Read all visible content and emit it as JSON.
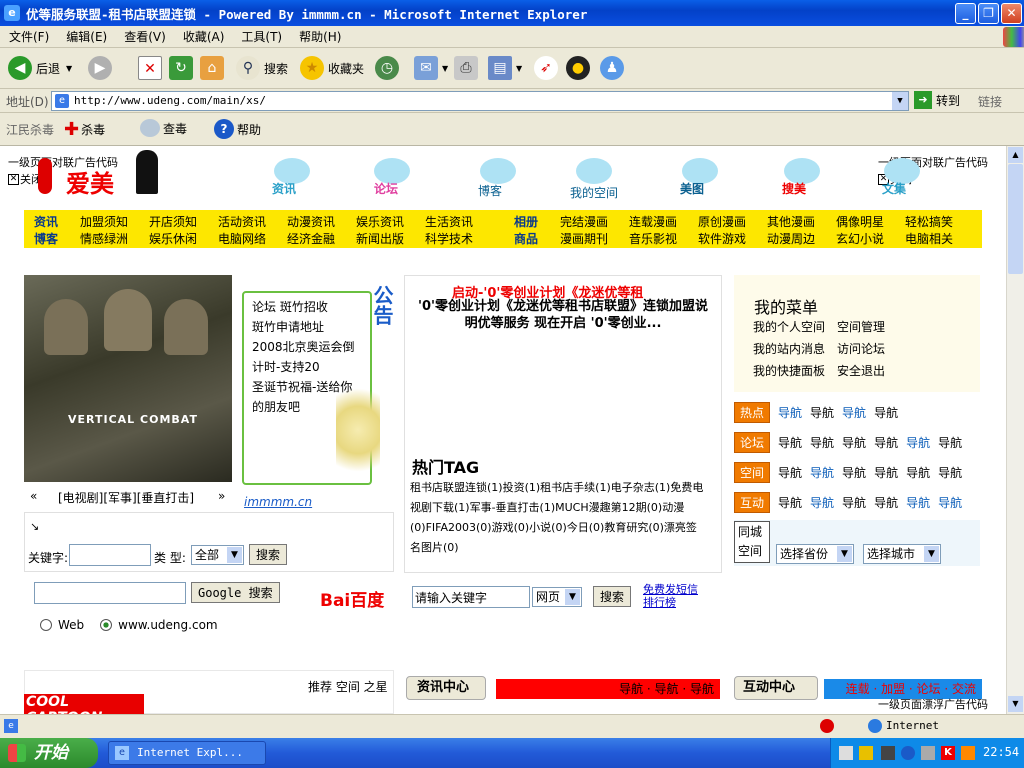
{
  "window": {
    "title": "优等服务联盟-租书店联盟连锁 - Powered By immmm.cn - Microsoft Internet Explorer",
    "minimize": "_",
    "maximize": "❐",
    "close": "✕"
  },
  "menu": [
    "文件(F)",
    "编辑(E)",
    "查看(V)",
    "收藏(A)",
    "工具(T)",
    "帮助(H)"
  ],
  "toolbar": {
    "back": "后退",
    "search": "搜索",
    "favorites": "收藏夹"
  },
  "address": {
    "label": "地址(D)",
    "url": "http://www.udeng.com/main/xs/",
    "go": "转到",
    "links": "链接"
  },
  "linksbar": {
    "label": "江民杀毒",
    "kill": "杀毒",
    "scan": "查毒",
    "help": "帮助"
  },
  "page": {
    "ad_left_text": "一级页面对联广告代码",
    "ad_left_close": "关闭",
    "ad_right_text": "一级页面对联广告代码",
    "ad_right_close": "关闭",
    "logo_text": "爱美",
    "nav_icons": [
      "资讯",
      "论坛",
      "博客",
      "我的空间",
      "美图",
      "搜美",
      "文集"
    ],
    "nav_row1_head": "资讯",
    "nav_row1": [
      "加盟须知",
      "开店须知",
      "活动资讯",
      "动漫资讯",
      "娱乐资讯",
      "生活资讯"
    ],
    "nav_row1_head2": "相册",
    "nav_row1b": [
      "完结漫画",
      "连载漫画",
      "原创漫画",
      "其他漫画",
      "偶像明星",
      "轻松搞笑"
    ],
    "nav_row2_head": "博客",
    "nav_row2": [
      "情感绿洲",
      "娱乐休闲",
      "电脑网络",
      "经济金融",
      "新闻出版",
      "科学技术"
    ],
    "nav_row2_head2": "商品",
    "nav_row2b": [
      "漫画期刊",
      "音乐影视",
      "软件游戏",
      "动漫周边",
      "玄幻小说",
      "电脑相关"
    ],
    "movie_caption": "[电视剧][军事][垂直打击]",
    "movie_prev": "«",
    "movie_next": "»",
    "movie_poster_text": "VERTICAL COMBAT",
    "notice_title": "公告",
    "notice_lines": [
      "论坛 斑竹招收",
      "斑竹申请地址",
      "2008北京奥运会倒",
      "计时-支持20",
      "圣诞节祝福-送给你",
      "的朋友吧"
    ],
    "notice_footer": "immmm.cn",
    "headline_red": "启动-'0'零创业计划《龙迷优等租",
    "headline_body": "'0'零创业计划《龙迷优等租书店联盟》连锁加盟说明优等服务 现在开启 '0'零创业...",
    "tag_title": "热门TAG",
    "tags": "租书店联盟连锁(1)投资(1)租书店手续(1)电子杂志(1)免费电视剧下载(1)军事-垂直打击(1)MUCH漫趣第12期(0)动漫(0)FIFA2003(0)游戏(0)小说(0)今日(0)教育研究(0)漂亮签名图片(0)",
    "search_keyword_label": "关键字:",
    "search_type_label": "类 型:",
    "search_type_value": "全部",
    "search_button": "搜索",
    "menu_title": "我的菜单",
    "menu_items": [
      "我的个人空间",
      "空间管理",
      "我的站内消息",
      "访问论坛",
      "我的快捷面板",
      "安全退出"
    ],
    "nav_tags": [
      {
        "tag": "热点",
        "links": [
          "导航",
          "导航",
          "导航",
          "导航"
        ]
      },
      {
        "tag": "论坛",
        "links": [
          "导航",
          "导航",
          "导航",
          "导航",
          "导航",
          "导航"
        ]
      },
      {
        "tag": "空间",
        "links": [
          "导航",
          "导航",
          "导航",
          "导航",
          "导航",
          "导航"
        ]
      },
      {
        "tag": "互动",
        "links": [
          "导航",
          "导航",
          "导航",
          "导航",
          "导航",
          "导航"
        ]
      }
    ],
    "city_label": "同城空间",
    "province_select": "选择省份",
    "city_select": "选择城市",
    "google_button": "Google 搜索",
    "radio_web": "Web",
    "radio_site": "www.udeng.com",
    "baidu_logo": "Bai百度",
    "baidu_input": "请输入关键字",
    "baidu_type": "网页",
    "baidu_button": "搜索",
    "baidu_links": "免费发短信 排行榜",
    "recommend": "推荐 空间 之星",
    "cartoon_banner": "COOL CARTOON",
    "news_center": "资讯中心",
    "news_nav": "导航 · 导航 · 导航",
    "interact_center": "互动中心",
    "interact_nav": "连载 · 加盟 · 论坛 · 交流",
    "float_ad": "一级页面漂浮广告代码"
  },
  "status": {
    "zone": "Internet"
  },
  "taskbar": {
    "start": "开始",
    "task": "Internet Expl...",
    "clock": "22:54"
  },
  "colors": {
    "title_blue": "#0a4ee0",
    "nav_yellow": "#fde700",
    "tag_orange": "#f07a00",
    "news_red": "#ff0000",
    "interact_blue": "#1a8ae8"
  }
}
